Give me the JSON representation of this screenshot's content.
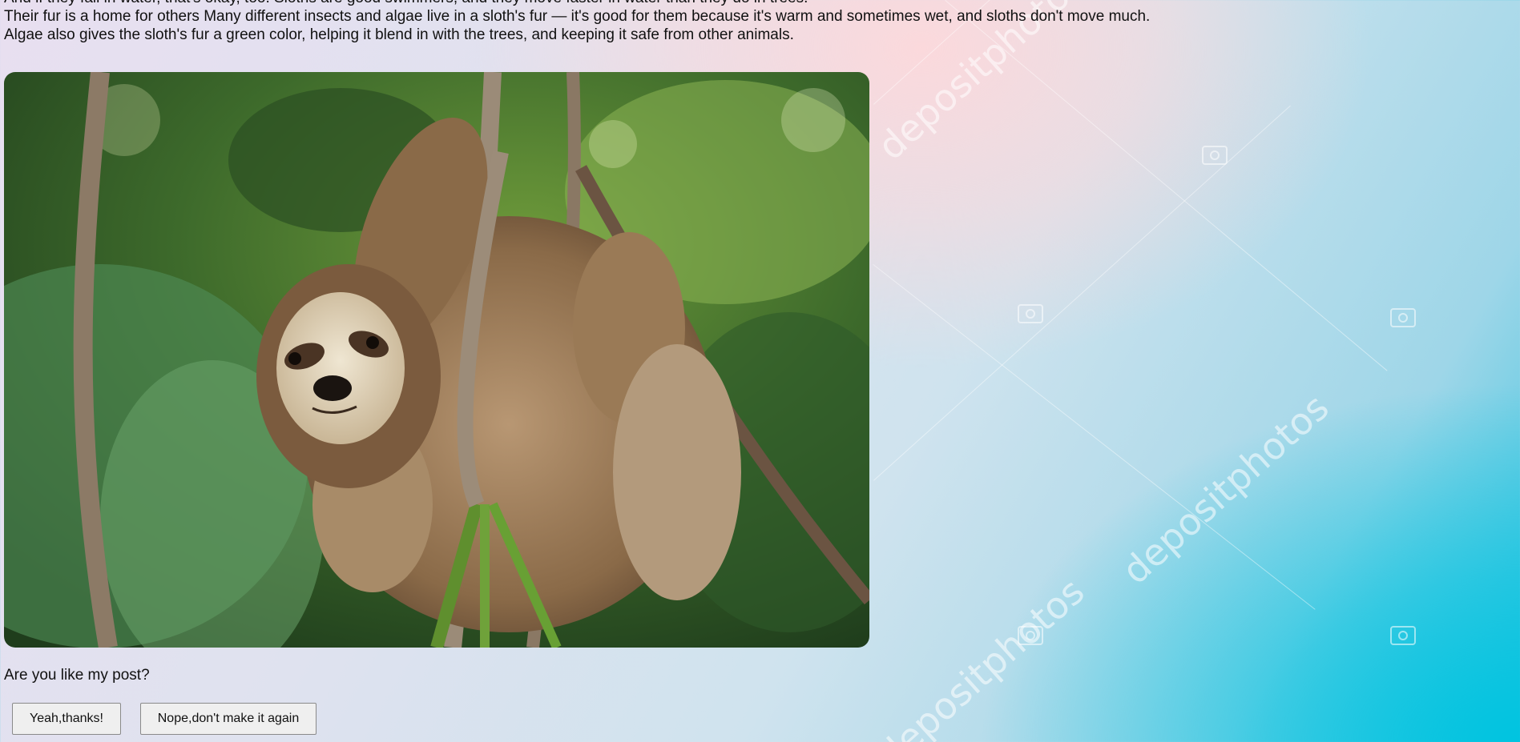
{
  "article": {
    "partial_line": "And if they fall in water, that's okay, too. Sloths are good swimmers, and they move faster in water than they do in trees.",
    "paragraph_line_1": "Their fur is a home for others Many different insects and algae live in a sloth's fur — it's good for them because it's warm and sometimes wet, and sloths don't move much.",
    "paragraph_line_2": "Algae also gives the sloth's fur a green color, helping it blend in with the trees, and keeping it safe from other animals."
  },
  "image": {
    "subject": "three-toed sloth hanging from branches in a rainforest"
  },
  "watermark": {
    "text": "depositphotos",
    "icon": "camera-icon"
  },
  "feedback": {
    "question": "Are you like my post?",
    "yes_label": "Yeah,thanks!",
    "no_label": "Nope,don't make it again"
  },
  "colors": {
    "background_cyan": "#00c4e0",
    "background_pink": "#fbd9dc",
    "button_bg": "#efefef"
  }
}
